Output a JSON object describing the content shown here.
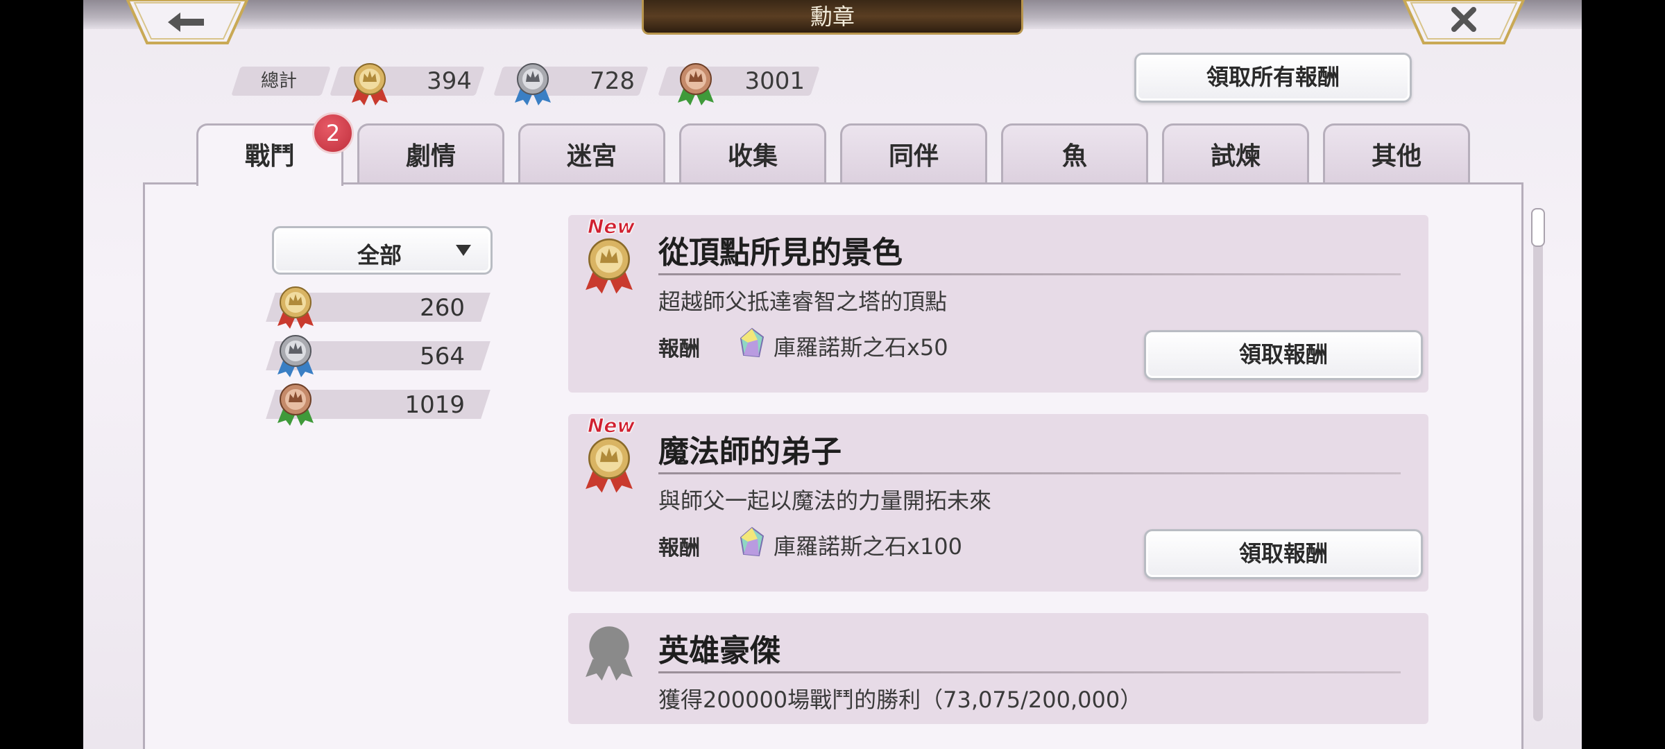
{
  "header": {
    "title": "勳章"
  },
  "totals": {
    "label": "總計",
    "gold": "394",
    "silver": "728",
    "bronze": "3001"
  },
  "claim_all_label": "領取所有報酬",
  "tabs": [
    {
      "label": "戰鬥",
      "active": true
    },
    {
      "label": "劇情"
    },
    {
      "label": "迷宮"
    },
    {
      "label": "收集"
    },
    {
      "label": "同伴"
    },
    {
      "label": "魚"
    },
    {
      "label": "試煉"
    },
    {
      "label": "其他"
    }
  ],
  "badge_count": "2",
  "filter": {
    "selected": "全部"
  },
  "counts": {
    "gold": "260",
    "silver": "564",
    "bronze": "1019"
  },
  "new_tag": "New",
  "medals": [
    {
      "title": "從頂點所見的景色",
      "desc": "超越師父抵達睿智之塔的頂點",
      "reward_label": "報酬",
      "reward": "庫羅諾斯之石x50",
      "button": "領取報酬",
      "is_new": true
    },
    {
      "title": "魔法師的弟子",
      "desc": "與師父一起以魔法的力量開拓未來",
      "reward_label": "報酬",
      "reward": "庫羅諾斯之石x100",
      "button": "領取報酬",
      "is_new": true
    },
    {
      "title": "英雄豪傑",
      "desc": "獲得200000場戰鬥的勝利（73,075/200,000）",
      "locked": true
    }
  ],
  "colors": {
    "gold_ribbon": "#c93a2e",
    "silver_ribbon": "#3a7fc4",
    "bronze_ribbon": "#3f9a3a",
    "badge": "#d23a48",
    "new_tag": "#d02030"
  }
}
